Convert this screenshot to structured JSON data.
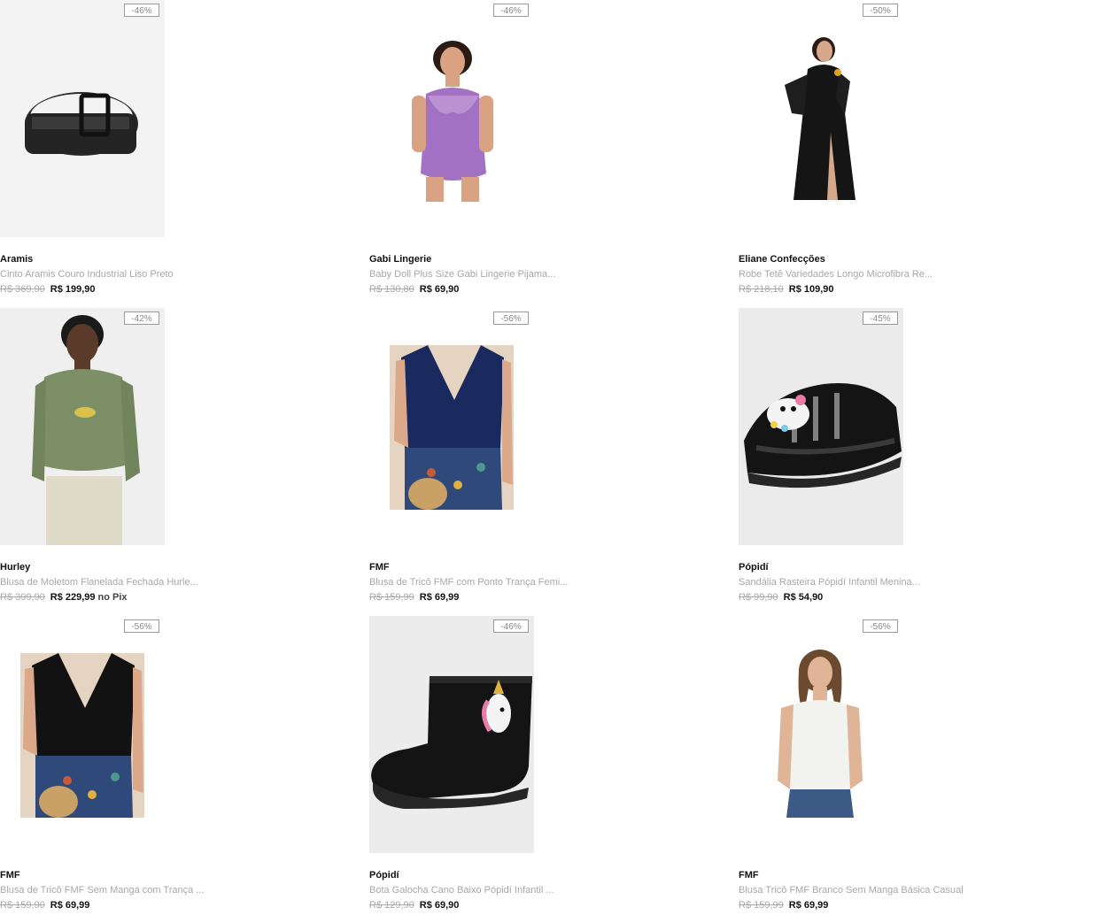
{
  "products": [
    {
      "discount": "-46%",
      "brand": "Aramis",
      "title": "Cinto Aramis Couro Industrial Liso Preto",
      "old_price": "R$ 369,90",
      "price": "R$ 199,90",
      "price_suffix": "",
      "image": "black-leather-belt"
    },
    {
      "discount": "-46%",
      "brand": "Gabi Lingerie",
      "title": "Baby Doll Plus Size Gabi Lingerie Pijama...",
      "old_price": "R$ 130,80",
      "price": "R$ 69,90",
      "price_suffix": "",
      "image": "purple-lace-babydoll"
    },
    {
      "discount": "-50%",
      "brand": "Eliane Confecções",
      "title": "Robe Tetê Variedades Longo Microfibra Re...",
      "old_price": "R$ 218,10",
      "price": "R$ 109,90",
      "price_suffix": "",
      "image": "black-long-robe"
    },
    {
      "discount": "-42%",
      "brand": "Hurley",
      "title": "Blusa de Moletom Flanelada Fechada Hurle...",
      "old_price": "R$ 399,90",
      "price": "R$ 229,99",
      "price_suffix": "no Pix",
      "image": "green-hoodie"
    },
    {
      "discount": "-56%",
      "brand": "FMF",
      "title": "Blusa de Tricô FMF com Ponto Trança Femi...",
      "old_price": "R$ 159,99",
      "price": "R$ 69,99",
      "price_suffix": "",
      "image": "navy-knit-top"
    },
    {
      "discount": "-45%",
      "brand": "Pópidí",
      "title": "Sandália Rasteira Pópidí Infantil Menina...",
      "old_price": "R$ 99,90",
      "price": "R$ 54,90",
      "price_suffix": "",
      "image": "black-jelly-sandal"
    },
    {
      "discount": "-56%",
      "brand": "FMF",
      "title": "Blusa de Tricô FMF Sem Manga com Trança ...",
      "old_price": "R$ 159,90",
      "price": "R$ 69,99",
      "price_suffix": "",
      "image": "black-knit-top"
    },
    {
      "discount": "-46%",
      "brand": "Pópidí",
      "title": "Bota Galocha Cano Baixo Pópidí Infantil ...",
      "old_price": "R$ 129,90",
      "price": "R$ 69,90",
      "price_suffix": "",
      "image": "black-rain-boot"
    },
    {
      "discount": "-56%",
      "brand": "FMF",
      "title": "Blusa Tricô FMF Branco Sem Manga Básica Casual",
      "old_price": "R$ 159,99",
      "price": "R$ 69,99",
      "price_suffix": "",
      "image": "white-knit-top"
    }
  ]
}
